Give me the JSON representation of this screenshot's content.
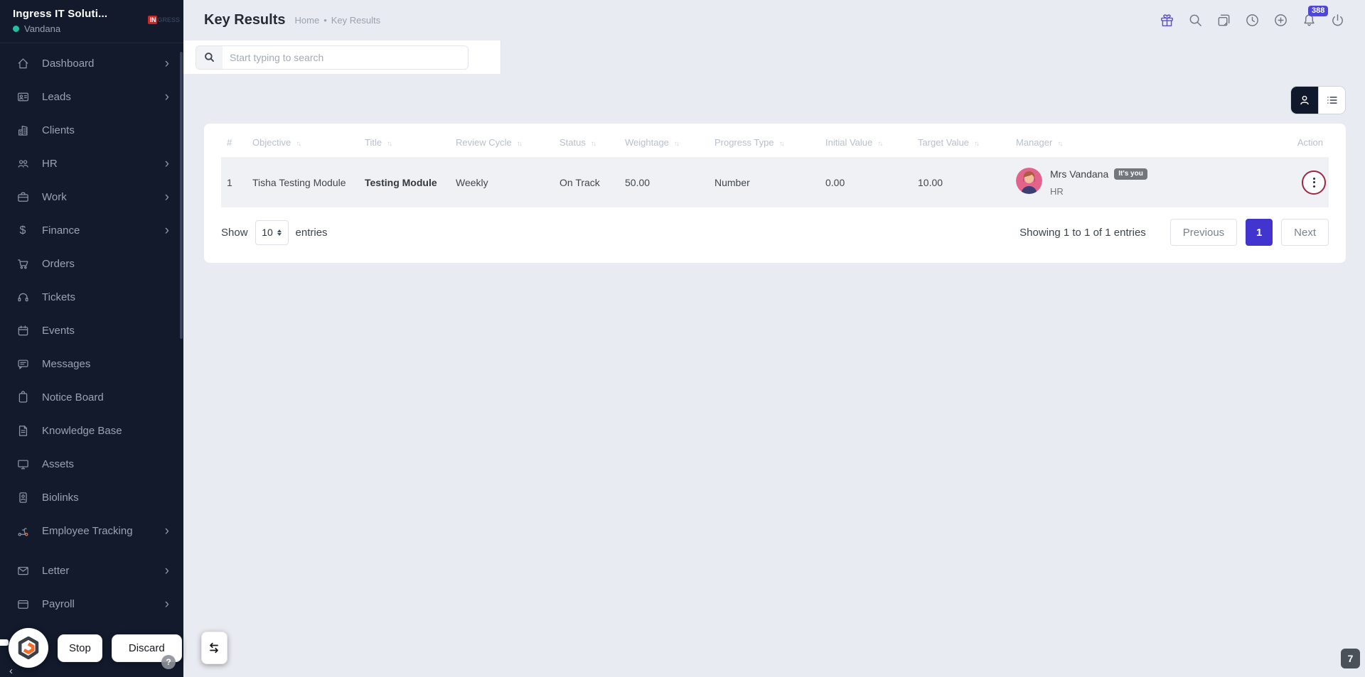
{
  "sidebar": {
    "org_name": "Ingress IT Soluti...",
    "user_name": "Vandana",
    "logo_badge": {
      "in": "IN",
      "rest": "GRESS"
    },
    "chevron_glyph": "›",
    "items": [
      {
        "label": "Dashboard",
        "icon": "home-icon",
        "chevron": true
      },
      {
        "label": "Leads",
        "icon": "leads-card-icon",
        "chevron": true
      },
      {
        "label": "Clients",
        "icon": "building-icon",
        "chevron": false
      },
      {
        "label": "HR",
        "icon": "people-icon",
        "chevron": true
      },
      {
        "label": "Work",
        "icon": "briefcase-icon",
        "chevron": true
      },
      {
        "label": "Finance",
        "icon": "dollar-icon",
        "chevron": true
      },
      {
        "label": "Orders",
        "icon": "cart-icon",
        "chevron": false
      },
      {
        "label": "Tickets",
        "icon": "headset-icon",
        "chevron": false
      },
      {
        "label": "Events",
        "icon": "calendar-icon",
        "chevron": false
      },
      {
        "label": "Messages",
        "icon": "chat-icon",
        "chevron": false
      },
      {
        "label": "Notice Board",
        "icon": "clipboard-icon",
        "chevron": false
      },
      {
        "label": "Knowledge Base",
        "icon": "document-icon",
        "chevron": false
      },
      {
        "label": "Assets",
        "icon": "monitor-icon",
        "chevron": false
      },
      {
        "label": "Biolinks",
        "icon": "id-badge-icon",
        "chevron": false
      },
      {
        "label": "Employee Tracking",
        "icon": "scooter-icon",
        "chevron": true
      },
      {
        "label": "Letter",
        "icon": "envelope-icon",
        "chevron": true
      },
      {
        "label": "Payroll",
        "icon": "wallet-icon",
        "chevron": true
      }
    ]
  },
  "header": {
    "title": "Key Results",
    "breadcrumb": [
      "Home",
      "Key Results"
    ],
    "breadcrumb_sep": "•",
    "notification_count": "388"
  },
  "toolbar": {
    "search_placeholder": "Start typing to search"
  },
  "table": {
    "sort_glyph": "↑↓",
    "columns": [
      "#",
      "Objective",
      "Title",
      "Review Cycle",
      "Status",
      "Weightage",
      "Progress Type",
      "Initial Value",
      "Target Value",
      "Manager",
      "Action"
    ],
    "rows": [
      {
        "num": "1",
        "objective": "Tisha Testing Module",
        "title": "Testing Module",
        "review_cycle": "Weekly",
        "status": "On Track",
        "weightage": "50.00",
        "progress_type": "Number",
        "initial_value": "0.00",
        "target_value": "10.00",
        "manager": {
          "name": "Mrs Vandana",
          "badge": "It's you",
          "role": "HR"
        }
      }
    ]
  },
  "pagination": {
    "show_label": "Show",
    "page_size": "10",
    "entries_label": "entries",
    "summary": "Showing 1 to 1 of 1 entries",
    "previous": "Previous",
    "current_page": "1",
    "next": "Next"
  },
  "overlay": {
    "stop": "Stop",
    "discard": "Discard",
    "help": "?",
    "collapse_glyph": "‹",
    "page_badge": "7"
  },
  "colors": {
    "sidebar_bg": "#121a2c",
    "page_bg": "#e9ebf2",
    "accent_indigo": "#4134cf",
    "notification_badge_purple": "#4f46d6",
    "gift_icon_purple": "#5b4ed2",
    "status_dot_teal": "#23bfa0",
    "action_ring_red": "#9c2742",
    "logo_red": "#c62828",
    "logo_orange": "#f26b2d"
  }
}
